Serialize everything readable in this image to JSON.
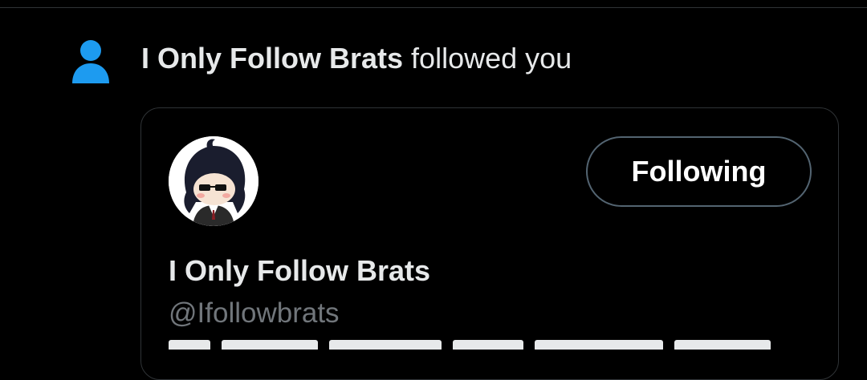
{
  "notification": {
    "icon": "person-icon",
    "icon_color": "#1d9bf0",
    "actor_name": "I Only Follow Brats",
    "action_text": " followed you"
  },
  "profile_card": {
    "display_name": "I Only Follow Brats",
    "handle": "@Ifollowbrats",
    "follow_button_label": "Following",
    "avatar": "anime-character-with-sunglasses-avatar"
  },
  "colors": {
    "background": "#000000",
    "text_primary": "#e7e9ea",
    "text_secondary": "#71767b",
    "accent": "#1d9bf0",
    "border": "#2f3336"
  }
}
